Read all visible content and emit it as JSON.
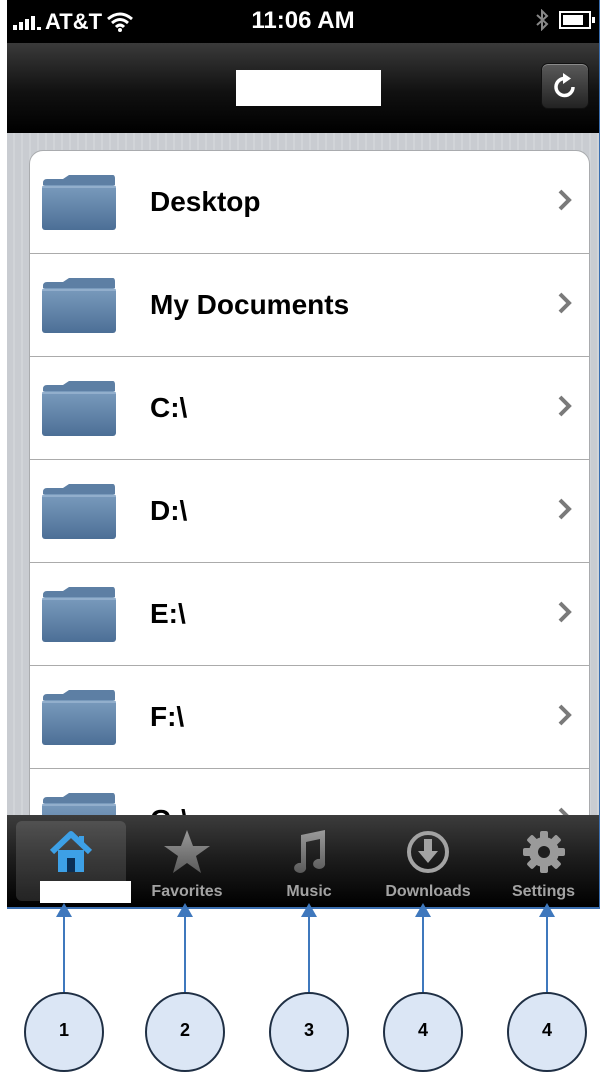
{
  "status_bar": {
    "carrier": "AT&T",
    "time": "11:06 AM"
  },
  "nav_bar": {
    "refresh_icon": "refresh-icon"
  },
  "folders": [
    {
      "label": "Desktop"
    },
    {
      "label": "My Documents"
    },
    {
      "label": "C:\\"
    },
    {
      "label": "D:\\"
    },
    {
      "label": "E:\\"
    },
    {
      "label": "F:\\"
    },
    {
      "label": "G:\\"
    }
  ],
  "tab_bar": {
    "tabs": [
      {
        "label": "",
        "icon": "home-icon",
        "selected": true
      },
      {
        "label": "Favorites",
        "icon": "star-icon"
      },
      {
        "label": "Music",
        "icon": "music-note-icon"
      },
      {
        "label": "Downloads",
        "icon": "download-icon"
      },
      {
        "label": "Settings",
        "icon": "gear-icon"
      }
    ]
  },
  "callouts": [
    "1",
    "2",
    "3",
    "4",
    "4"
  ],
  "colors": {
    "callout_fill": "#dbe6f5",
    "callout_arrow": "#3f78bd",
    "home_icon": "#3da0e6"
  }
}
